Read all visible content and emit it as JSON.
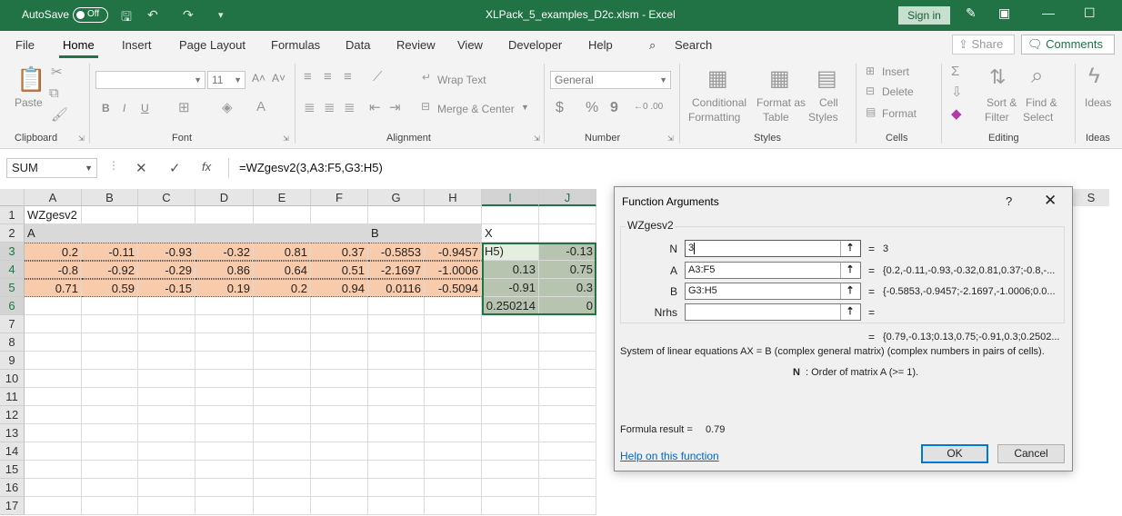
{
  "titlebar": {
    "autosave_label": "AutoSave",
    "autosave_state": "Off",
    "doc_title": "XLPack_5_examples_D2c.xlsm  -  Excel",
    "signin": "Sign in"
  },
  "tabs": [
    "File",
    "Home",
    "Insert",
    "Page Layout",
    "Formulas",
    "Data",
    "Review",
    "View",
    "Developer",
    "Help"
  ],
  "search_label": "Search",
  "share_label": "Share",
  "comments_label": "Comments",
  "ribbon": {
    "clipboard": {
      "label": "Clipboard",
      "paste": "Paste"
    },
    "font": {
      "label": "Font",
      "size": "11",
      "bold": "B",
      "italic": "I",
      "underline": "U"
    },
    "alignment": {
      "label": "Alignment",
      "wrap": "Wrap Text",
      "merge": "Merge & Center"
    },
    "number": {
      "label": "Number",
      "format": "General",
      "currency": "$",
      "percent": "%",
      "comma": "9"
    },
    "styles": {
      "label": "Styles",
      "conditional_1": "Conditional",
      "conditional_2": "Formatting",
      "format_as_1": "Format as",
      "format_as_2": "Table",
      "cell_styles_1": "Cell",
      "cell_styles_2": "Styles"
    },
    "cells": {
      "label": "Cells",
      "insert": "Insert",
      "delete": "Delete",
      "format": "Format"
    },
    "editing": {
      "label": "Editing",
      "sort_1": "Sort &",
      "sort_2": "Filter",
      "find_1": "Find &",
      "find_2": "Select"
    },
    "ideas": {
      "label": "Ideas",
      "btn": "Ideas"
    }
  },
  "formula_bar": {
    "name_box": "SUM",
    "formula": "=WZgesv2(3,A3:F5,G3:H5)"
  },
  "grid": {
    "columns": [
      "A",
      "B",
      "C",
      "D",
      "E",
      "F",
      "G",
      "H",
      "I",
      "J"
    ],
    "hidden_right_col": "S",
    "rows": [
      "1",
      "2",
      "3",
      "4",
      "5",
      "6",
      "7",
      "8",
      "9",
      "10",
      "11",
      "12",
      "13",
      "14",
      "15",
      "16",
      "17"
    ],
    "a1": "WZgesv2",
    "label_a": "A",
    "label_b": "B",
    "label_x": "X",
    "matrix_a": [
      [
        "0.2",
        "-0.11",
        "-0.93",
        "-0.32",
        "0.81",
        "0.37"
      ],
      [
        "-0.8",
        "-0.92",
        "-0.29",
        "0.86",
        "0.64",
        "0.51"
      ],
      [
        "0.71",
        "0.59",
        "-0.15",
        "0.19",
        "0.2",
        "0.94"
      ]
    ],
    "matrix_b": [
      [
        "-0.5853",
        "-0.9457"
      ],
      [
        "-2.1697",
        "-1.0006"
      ],
      [
        "0.0116",
        "-0.5094"
      ]
    ],
    "matrix_x": [
      [
        "H5)",
        "-0.13"
      ],
      [
        "0.13",
        "0.75"
      ],
      [
        "-0.91",
        "0.3"
      ],
      [
        "0.250214",
        "0"
      ]
    ]
  },
  "dialog": {
    "title": "Function Arguments",
    "help_q": "?",
    "close": "✕",
    "func_name": "WZgesv2",
    "args": [
      {
        "label": "N",
        "value": "3",
        "result": "3"
      },
      {
        "label": "A",
        "value": "A3:F5",
        "result": "{0.2,-0.11,-0.93,-0.32,0.81,0.37;-0.8,-..."
      },
      {
        "label": "B",
        "value": "G3:H5",
        "result": "{-0.5853,-0.9457;-2.1697,-1.0006;0.0..."
      },
      {
        "label": "Nrhs",
        "value": "",
        "result": ""
      }
    ],
    "eq": "=",
    "overall_result": "{0.79,-0.13;0.13,0.75;-0.91,0.3;0.2502...",
    "description": "System of linear equations AX = B (complex general matrix) (complex numbers in pairs of cells).",
    "arg_help_name": "N",
    "arg_help_text": ":  Order of matrix A (>= 1).",
    "formula_result_label": "Formula result =",
    "formula_result_value": "0.79",
    "help_link": "Help on this function",
    "ok": "OK",
    "cancel": "Cancel"
  }
}
